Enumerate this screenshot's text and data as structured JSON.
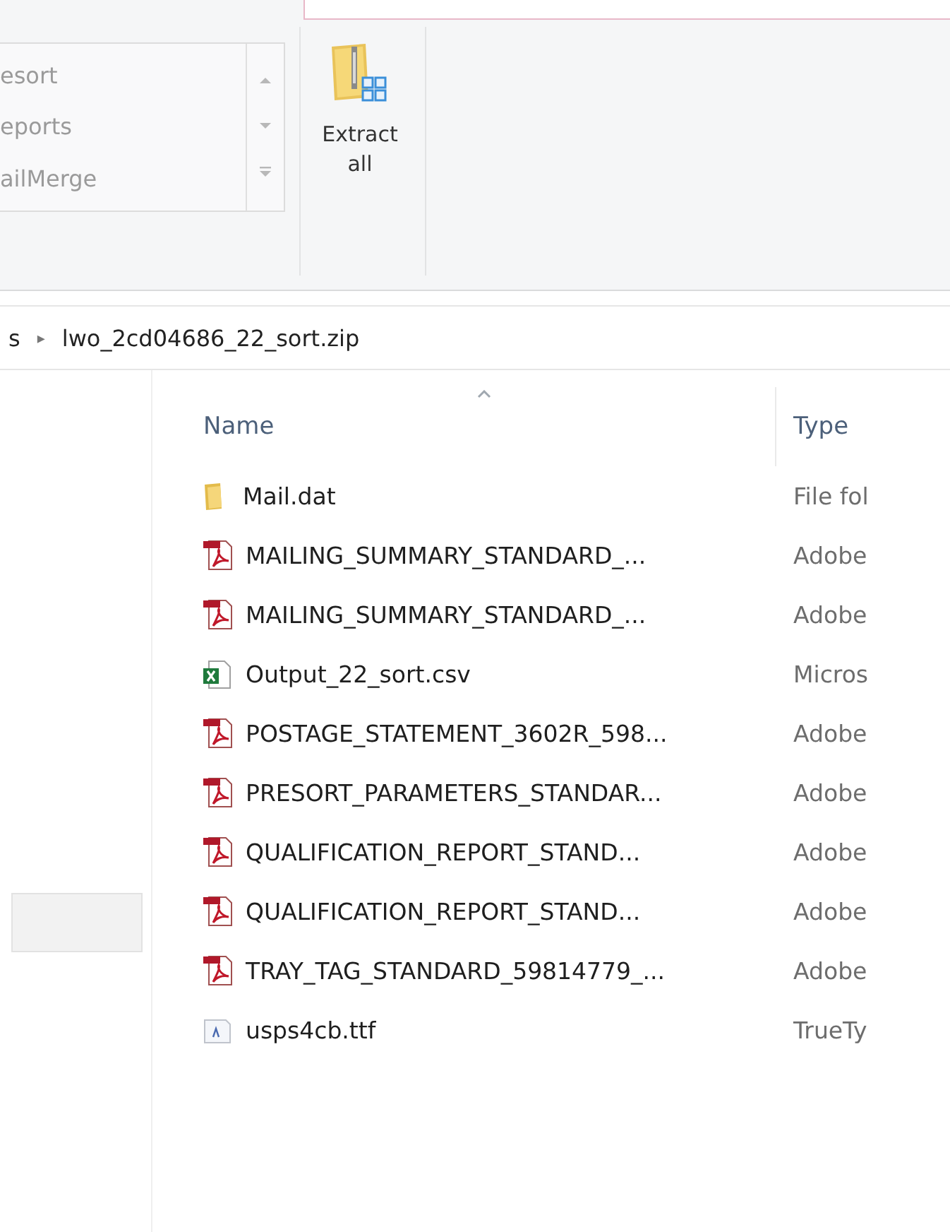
{
  "ribbon": {
    "gallery": [
      "esort",
      "eports",
      "ailMerge"
    ],
    "extract_button": "Extract all"
  },
  "address_bar": {
    "separator": "▸",
    "location": "lwo_2cd04686_22_sort.zip",
    "parent_fragment": "s"
  },
  "columns": [
    {
      "label": "Name",
      "sorted": true
    },
    {
      "label": "Type",
      "sorted": false
    }
  ],
  "rows": [
    {
      "kind": "folder",
      "name": "Mail.dat",
      "type": "File fol"
    },
    {
      "kind": "pdf",
      "name": "MAILING_SUMMARY_STANDARD_...",
      "type": "Adobe"
    },
    {
      "kind": "pdf",
      "name": "MAILING_SUMMARY_STANDARD_...",
      "type": "Adobe"
    },
    {
      "kind": "excel",
      "name": "Output_22_sort.csv",
      "type": "Micros"
    },
    {
      "kind": "pdf",
      "name": "POSTAGE_STATEMENT_3602R_598...",
      "type": "Adobe"
    },
    {
      "kind": "pdf",
      "name": "PRESORT_PARAMETERS_STANDAR...",
      "type": "Adobe"
    },
    {
      "kind": "pdf",
      "name": "QUALIFICATION_REPORT_STAND...",
      "type": "Adobe"
    },
    {
      "kind": "pdf",
      "name": "QUALIFICATION_REPORT_STAND...",
      "type": "Adobe"
    },
    {
      "kind": "pdf",
      "name": "TRAY_TAG_STANDARD_59814779_...",
      "type": "Adobe"
    },
    {
      "kind": "font",
      "name": "usps4cb.ttf",
      "type": "TrueTy"
    }
  ]
}
